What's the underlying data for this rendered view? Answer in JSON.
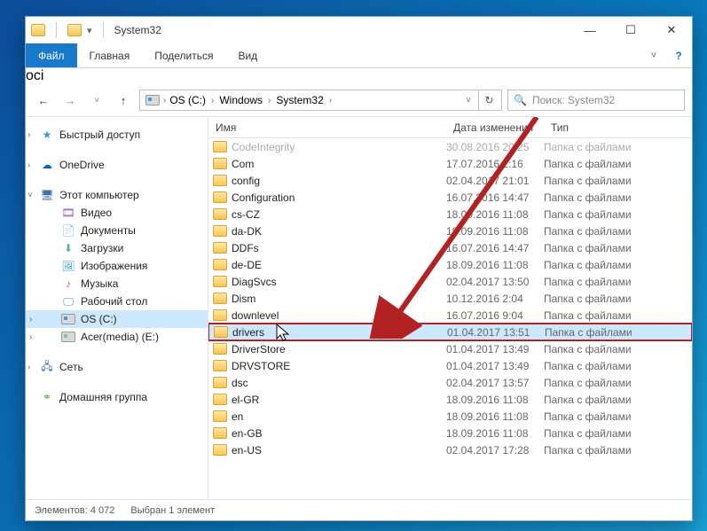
{
  "window_title": "System32",
  "ribbon_tabs": {
    "file": "Файл",
    "home": "Главная",
    "share": "Поделиться",
    "view": "Вид"
  },
  "breadcrumb": {
    "drive": "OS (C:)",
    "a": "Windows",
    "b": "System32"
  },
  "search_placeholder": "Поиск: System32",
  "sidebar": {
    "quick": "Быстрый доступ",
    "onedrive": "OneDrive",
    "thispc": "Этот компьютер",
    "pc": {
      "video": "Видео",
      "docs": "Документы",
      "downloads": "Загрузки",
      "pictures": "Изображения",
      "music": "Музыка",
      "desktop": "Рабочий стол",
      "drive_c": "OS (C:)",
      "drive_e": "Acer(media) (E:)"
    },
    "network": "Сеть",
    "homegroup": "Домашняя группа"
  },
  "columns": {
    "name": "Имя",
    "date": "Дата изменения",
    "type": "Тип"
  },
  "folder_type": "Папка с файлами",
  "rows": [
    {
      "name": "CodeIntegrity",
      "date": "30.08.2016 20:25",
      "faded": true
    },
    {
      "name": "Com",
      "date": "17.07.2016 2:16"
    },
    {
      "name": "config",
      "date": "02.04.2017 21:01"
    },
    {
      "name": "Configuration",
      "date": "16.07.2016 14:47"
    },
    {
      "name": "cs-CZ",
      "date": "18.09.2016 11:08"
    },
    {
      "name": "da-DK",
      "date": "18.09.2016 11:08"
    },
    {
      "name": "DDFs",
      "date": "16.07.2016 14:47"
    },
    {
      "name": "de-DE",
      "date": "18.09.2016 11:08"
    },
    {
      "name": "DiagSvcs",
      "date": "02.04.2017 13:50"
    },
    {
      "name": "Dism",
      "date": "10.12.2016 2:04"
    },
    {
      "name": "downlevel",
      "date": "16.07.2016 9:04"
    },
    {
      "name": "drivers",
      "date": "01.04.2017 13:51",
      "highlighted": true
    },
    {
      "name": "DriverStore",
      "date": "01.04.2017 13:49"
    },
    {
      "name": "DRVSTORE",
      "date": "01.04.2017 13:49"
    },
    {
      "name": "dsc",
      "date": "02.04.2017 13:57"
    },
    {
      "name": "el-GR",
      "date": "18.09.2016 11:08"
    },
    {
      "name": "en",
      "date": "18.09.2016 11:08"
    },
    {
      "name": "en-GB",
      "date": "18.09.2016 11:08"
    },
    {
      "name": "en-US",
      "date": "02.04.2017 17:28"
    }
  ],
  "statusbar": {
    "count_label": "Элементов:",
    "count": "4 072",
    "selection": "Выбран 1 элемент"
  }
}
